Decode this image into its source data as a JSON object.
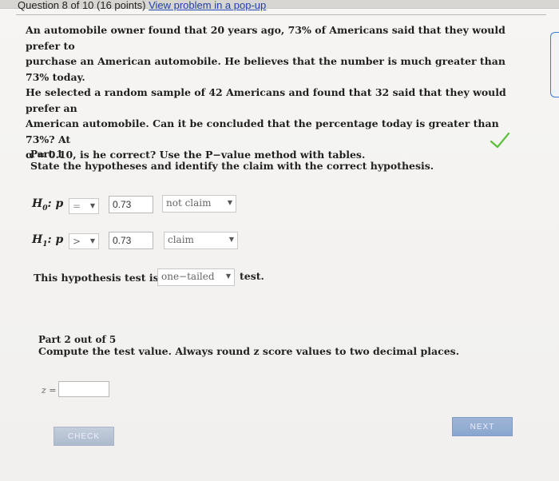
{
  "header": {
    "question_progress": "Question 8 of 10 (16 points)",
    "popup_link": "View problem in a pop-up"
  },
  "problem": {
    "lines": [
      "An automobile owner found that 20 years ago, 73% of Americans said that they would prefer to",
      "purchase an American automobile. He believes that the number is much greater than 73% today.",
      "He selected a random sample of 42 Americans and found that 32 said that they would prefer an",
      "American automobile. Can it be concluded that the percentage today is greater than 73%? At",
      "α = 0.10, is he correct? Use the P−value method with tables."
    ]
  },
  "part1": {
    "title": "Part 1",
    "instruction": "State the hypotheses and identify the claim with the correct hypothesis.",
    "status_icon": "checkmark-icon",
    "h0": {
      "label": "H",
      "sub": "0",
      "var": ": p",
      "operator": "=",
      "value": "0.73",
      "claim": "not claim"
    },
    "h1": {
      "label": "H",
      "sub": "1",
      "var": ": p",
      "operator": ">",
      "value": "0.73",
      "claim": "claim"
    },
    "test_prefix": "This hypothesis test is a",
    "test_type": "one−tailed",
    "test_suffix": "test."
  },
  "part2": {
    "title": "Part 2 out of 5",
    "instruction": "Compute the test value. Always round z score values to two decimal places.",
    "z_label": "z =",
    "z_value": ""
  },
  "buttons": {
    "check": "CHECK",
    "next": "NEXT"
  },
  "colors": {
    "accent": "#3a7bd5",
    "check_green": "#5cbf3a",
    "link": "#1f3fae"
  }
}
